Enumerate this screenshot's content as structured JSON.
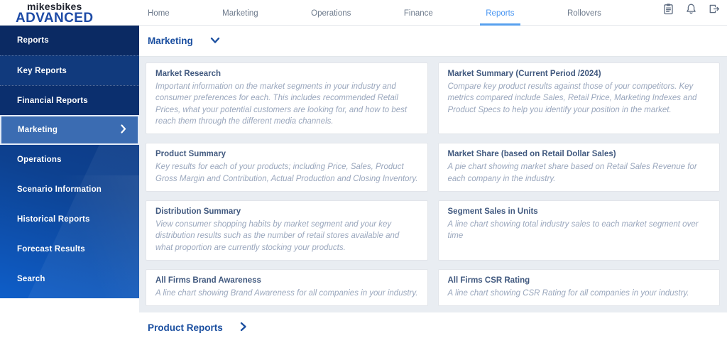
{
  "header": {
    "logo": {
      "line1": "mikesbikes",
      "line2": "ADVANCED"
    },
    "nav": [
      {
        "label": "Home",
        "active": false
      },
      {
        "label": "Marketing",
        "active": false
      },
      {
        "label": "Operations",
        "active": false
      },
      {
        "label": "Finance",
        "active": false
      },
      {
        "label": "Reports",
        "active": true
      },
      {
        "label": "Rollovers",
        "active": false
      }
    ],
    "action_icons": [
      "clipboard-icon",
      "bell-icon",
      "logout-icon"
    ]
  },
  "sidebar": {
    "items": [
      {
        "label": "Reports",
        "active": false
      },
      {
        "label": "Key Reports",
        "active": false
      },
      {
        "label": "Financial Reports",
        "active": false
      },
      {
        "label": "Marketing",
        "active": true
      },
      {
        "label": "Operations",
        "active": false
      },
      {
        "label": "Scenario Information",
        "active": false
      },
      {
        "label": "Historical Reports",
        "active": false
      },
      {
        "label": "Forecast Results",
        "active": false
      },
      {
        "label": "Search",
        "active": false
      }
    ]
  },
  "main": {
    "section_title": "Marketing",
    "footer_section_title": "Product Reports",
    "cards": [
      {
        "title": "Market Research",
        "description": "Important information on the market segments in your industry and consumer preferences for each. This includes recommended Retail Prices, what your potential customers are looking for, and how to best reach them through the different media channels."
      },
      {
        "title": "Market Summary (Current Period /2024)",
        "description": "Compare key product results against those of your competitors. Key metrics compared include Sales, Retail Price, Marketing Indexes and Product Specs to help you identify your position in the market."
      },
      {
        "title": "Product Summary",
        "description": "Key results for each of your products; including Price, Sales, Product Gross Margin and Contribution, Actual Production and Closing Inventory."
      },
      {
        "title": "Market Share (based on Retail Dollar Sales)",
        "description": "A pie chart showing market share based on Retail Sales Revenue for each company in the industry."
      },
      {
        "title": "Distribution Summary",
        "description": "View consumer shopping habits by market segment and your key distribution results such as the number of retail stores available and what proportion are currently stocking your products."
      },
      {
        "title": "Segment Sales in Units",
        "description": "A line chart showing total industry sales to each market segment over time"
      },
      {
        "title": "All Firms Brand Awareness",
        "description": "A line chart showing Brand Awareness for all companies in your industry."
      },
      {
        "title": "All Firms CSR Rating",
        "description": "A line chart showing CSR Rating for all companies in your industry."
      }
    ]
  },
  "colors": {
    "accent_blue": "#1e4ba6",
    "nav_active_blue": "#4b97f2",
    "sidebar_top": "#0b2a63",
    "sidebar_bottom": "#0e5ec9",
    "sidebar_active": "#3b6cb2",
    "grid_background": "#e9edf2",
    "card_title": "#41597f",
    "card_description": "#9aa7bd"
  }
}
